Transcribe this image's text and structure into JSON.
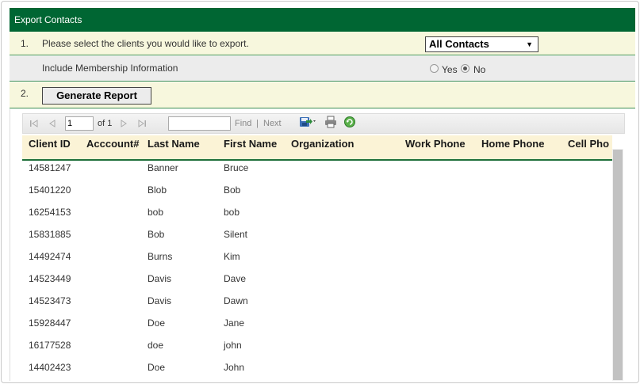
{
  "header": {
    "title": "Export Contacts"
  },
  "step1": {
    "number": "1.",
    "label": "Please select the clients you would like to export.",
    "select_value": "All Contacts",
    "select_arrow": "▼"
  },
  "membership": {
    "label": "Include Membership Information",
    "yes_label": "Yes",
    "no_label": "No",
    "selected": "No"
  },
  "step2": {
    "number": "2.",
    "button_label": "Generate Report"
  },
  "toolbar": {
    "page_value": "1",
    "of_label": "of 1",
    "find_label": "Find",
    "separator": "|",
    "next_label": "Next",
    "icons": [
      "first-page-icon",
      "prev-page-icon",
      "next-page-icon",
      "last-page-icon",
      "export-save-icon",
      "print-icon",
      "refresh-icon"
    ]
  },
  "table": {
    "columns": [
      "Client ID",
      "Acccount#",
      "Last Name",
      "First Name",
      "Organization",
      "Work Phone",
      "Home Phone",
      "Cell Pho"
    ],
    "rows": [
      [
        "14581247",
        "",
        "Banner",
        "Bruce"
      ],
      [
        "15401220",
        "",
        "Blob",
        "Bob"
      ],
      [
        "16254153",
        "",
        "bob",
        "bob"
      ],
      [
        "15831885",
        "",
        "Bob",
        "Silent"
      ],
      [
        "14492474",
        "",
        "Burns",
        "Kim"
      ],
      [
        "14523449",
        "",
        "Davis",
        "Dave"
      ],
      [
        "14523473",
        "",
        "Davis",
        "Dawn"
      ],
      [
        "15928447",
        "",
        "Doe",
        "Jane"
      ],
      [
        "16177528",
        "",
        "doe",
        "john"
      ],
      [
        "14402423",
        "",
        "Doe",
        "John"
      ]
    ]
  },
  "colors": {
    "header_green": "#006633",
    "row_cream": "#f7f7dd",
    "row_gray": "#ececec",
    "grid_head": "#fbf3d6"
  }
}
